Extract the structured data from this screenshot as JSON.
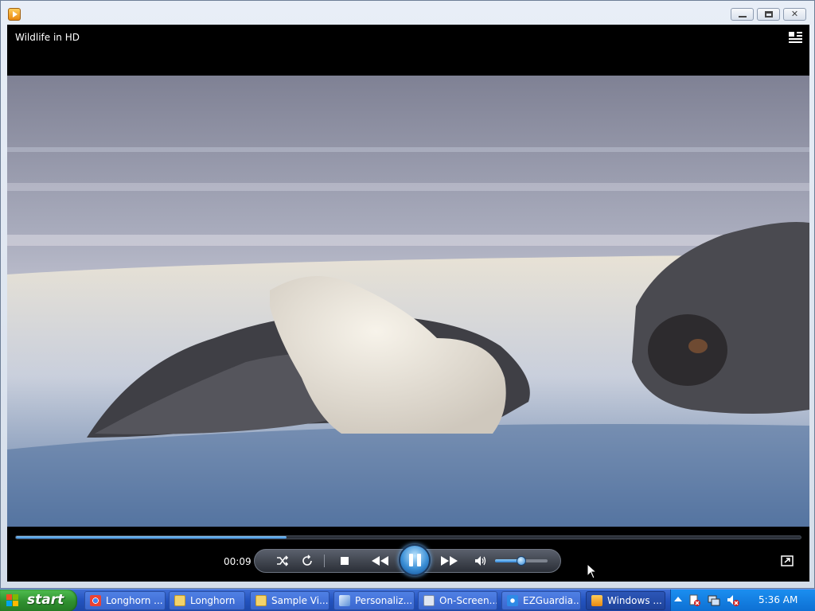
{
  "window": {
    "controls": [
      "minimize",
      "maximize",
      "close"
    ]
  },
  "player": {
    "now_playing_title": "Wildlife in HD",
    "elapsed_time": "00:09",
    "seek_progress": 0.345,
    "volume_level": 0.5,
    "controls": [
      "shuffle",
      "repeat",
      "stop",
      "previous",
      "pause",
      "next",
      "mute"
    ]
  },
  "taskbar": {
    "start_label": "start",
    "tasks": [
      {
        "label": "Longhorn ...",
        "icon": "chrome-icon",
        "active": false
      },
      {
        "label": "Longhorn",
        "icon": "folder-icon",
        "active": false
      },
      {
        "label": "Sample Vi...",
        "icon": "folder-icon",
        "active": false
      },
      {
        "label": "Personaliz...",
        "icon": "control-panel-icon",
        "active": false
      },
      {
        "label": "On-Screen...",
        "icon": "keyboard-icon",
        "active": false
      },
      {
        "label": "EZGuardia...",
        "icon": "ie-icon",
        "active": false
      },
      {
        "label": "Windows ...",
        "icon": "media-player-icon",
        "active": true
      }
    ],
    "clock": "5:36 AM"
  },
  "colors": {
    "accent_blue": "#2e7fd1",
    "taskbar_blue": "#2353bf",
    "start_green": "#2f8f2f",
    "tray_blue": "#0d6fd2"
  }
}
